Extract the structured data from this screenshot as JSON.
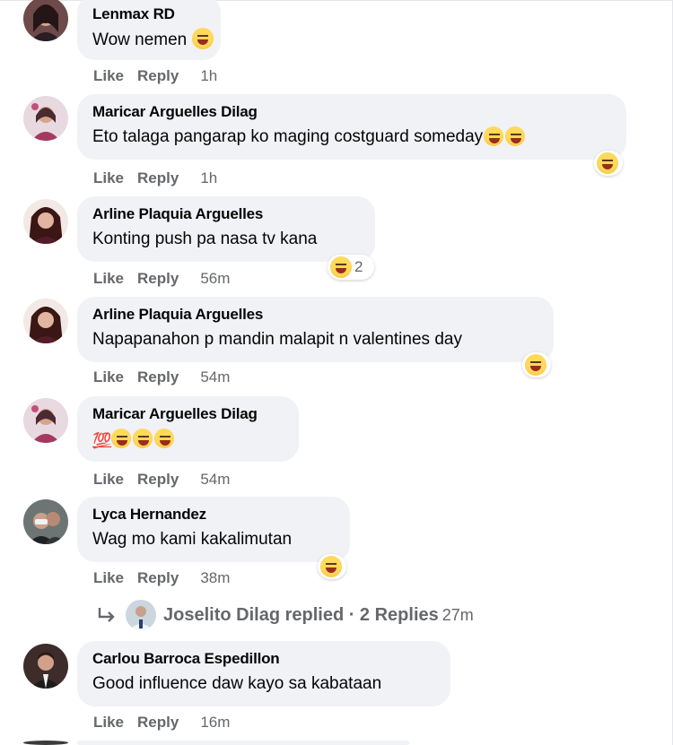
{
  "comments": [
    {
      "author": "Lenmax RD",
      "text": "Wow nemen",
      "like": "Like",
      "reply": "Reply",
      "time": "1h",
      "reaction_count": ""
    },
    {
      "author": "Maricar Arguelles Dilag",
      "text": "Eto talaga pangarap ko maging costguard someday",
      "like": "Like",
      "reply": "Reply",
      "time": "1h",
      "reaction_count": ""
    },
    {
      "author": "Arline Plaquia Arguelles",
      "text": "Konting push pa nasa tv kana",
      "like": "Like",
      "reply": "Reply",
      "time": "56m",
      "reaction_count": "2"
    },
    {
      "author": "Arline Plaquia Arguelles",
      "text": "Napapanahon p mandin malapit n valentines day",
      "like": "Like",
      "reply": "Reply",
      "time": "54m",
      "reaction_count": ""
    },
    {
      "author": "Maricar Arguelles Dilag",
      "text": "💯",
      "like": "Like",
      "reply": "Reply",
      "time": "54m",
      "reaction_count": ""
    },
    {
      "author": "Lyca Hernandez",
      "text": "Wag mo kami kakalimutan",
      "like": "Like",
      "reply": "Reply",
      "time": "38m",
      "reaction_count": ""
    },
    {
      "author": "Carlou Barroca Espedillon",
      "text": "Good influence daw kayo sa kabataan",
      "like": "Like",
      "reply": "Reply",
      "time": "16m",
      "reaction_count": ""
    }
  ],
  "replies": {
    "text": "Joselito Dilag replied · 2 Replies",
    "time": "27m"
  },
  "icons": {
    "reaction_emoji": "laughing-face-icon",
    "heart_eyes_emoji": "heart-eyes-icon",
    "grinning_emoji": "grinning-sweat-icon",
    "rofl_emoji": "rolling-laughing-icon",
    "hundred_emoji": "hundred-points-icon",
    "reply_arrow": "reply-arrow-icon"
  },
  "colors": {
    "bubble": "#f0f2f5",
    "meta_text": "#65676b",
    "primary_text": "#050505"
  }
}
